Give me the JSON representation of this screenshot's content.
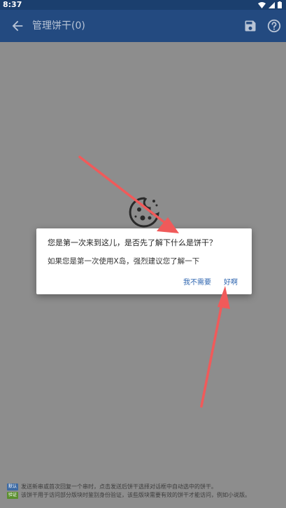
{
  "status_bar": {
    "time": "8:37",
    "icons": [
      "wifi-icon",
      "signal-icon",
      "battery-icon"
    ]
  },
  "app_bar": {
    "title": "管理饼干(0)",
    "icons": [
      "back-arrow-icon",
      "save-icon",
      "help-icon"
    ]
  },
  "dialog": {
    "title": "您是第一次来到这儿，是否先了解下什么是饼干？",
    "message": "如果您是第一次使用X岛，强烈建议您了解一下",
    "negative_button": "我不需要",
    "positive_button": "好啊"
  },
  "notes": [
    {
      "badge": "默认",
      "text": "发送新串或首次回复一个串时，点击发送后饼干选择对话框中自动选中的饼干。"
    },
    {
      "badge": "验证",
      "text": "该饼干用于访问部分版块时鉴别身份验证，该些版块需要有效的饼干才能访问，例如小说版。"
    }
  ],
  "colors": {
    "app_bar": "#234a80",
    "status_bar": "#1b3f6e",
    "scrim": "#8d8d8d",
    "dialog_button": "#2f66b0",
    "annotation_arrow": "#f05a5a"
  }
}
